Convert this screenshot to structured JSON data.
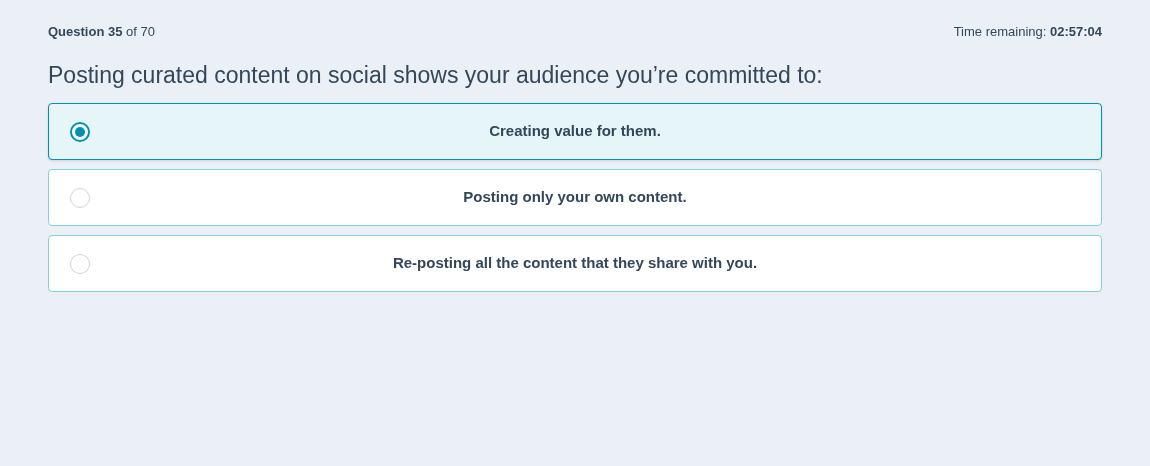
{
  "progress": "**Question 35** of 70",
  "timer": "Time remaining: **02:57:04**",
  "question": "Posting curated content on social shows your audience you’re committed to:",
  "options": [
    {
      "label": "Creating value for them.",
      "selected": true
    },
    {
      "label": "Posting only your own content.",
      "selected": false
    },
    {
      "label": "Re-posting all the content that they share with you.",
      "selected": false
    }
  ]
}
